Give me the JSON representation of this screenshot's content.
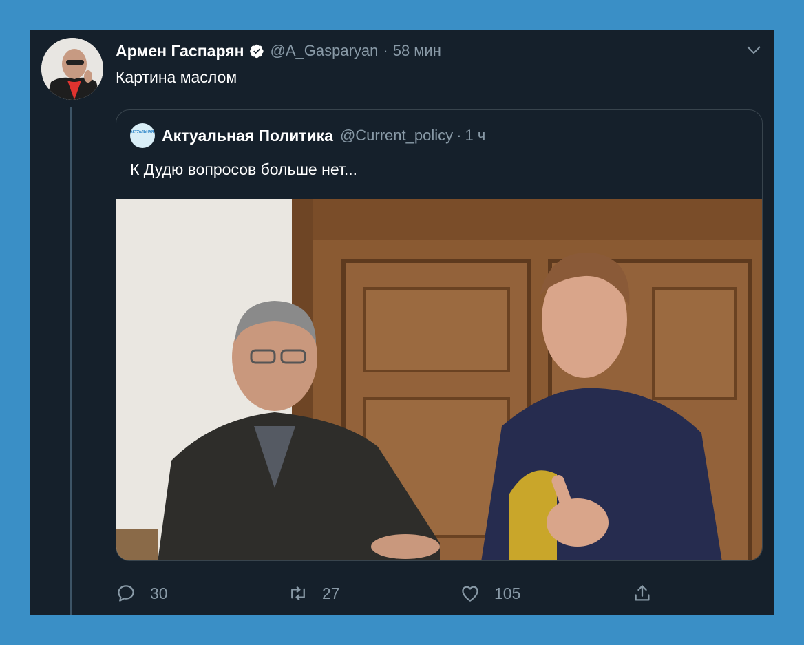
{
  "tweet": {
    "author_name": "Армен Гаспарян",
    "handle": "@A_Gasparyan",
    "separator": "·",
    "time": "58 мин",
    "text": "Картина маслом"
  },
  "quoted_tweet": {
    "author_name": "Актуальная Политика",
    "handle": "@Current_policy",
    "separator": "·",
    "time": "1 ч",
    "text": "К Дудю вопросов больше нет...",
    "avatar_text": "АКТУАЛЬНАЯ ПОЛИТИКА"
  },
  "actions": {
    "replies": "30",
    "retweets": "27",
    "likes": "105"
  },
  "colors": {
    "page_background": "#3a8fc6",
    "card_background": "#15202b",
    "text_primary": "#ffffff",
    "text_secondary": "#8899a6",
    "verified_badge": "#ffffff"
  },
  "icons": [
    "verified-icon",
    "chevron-down-icon",
    "reply-icon",
    "retweet-icon",
    "like-icon",
    "share-icon"
  ]
}
